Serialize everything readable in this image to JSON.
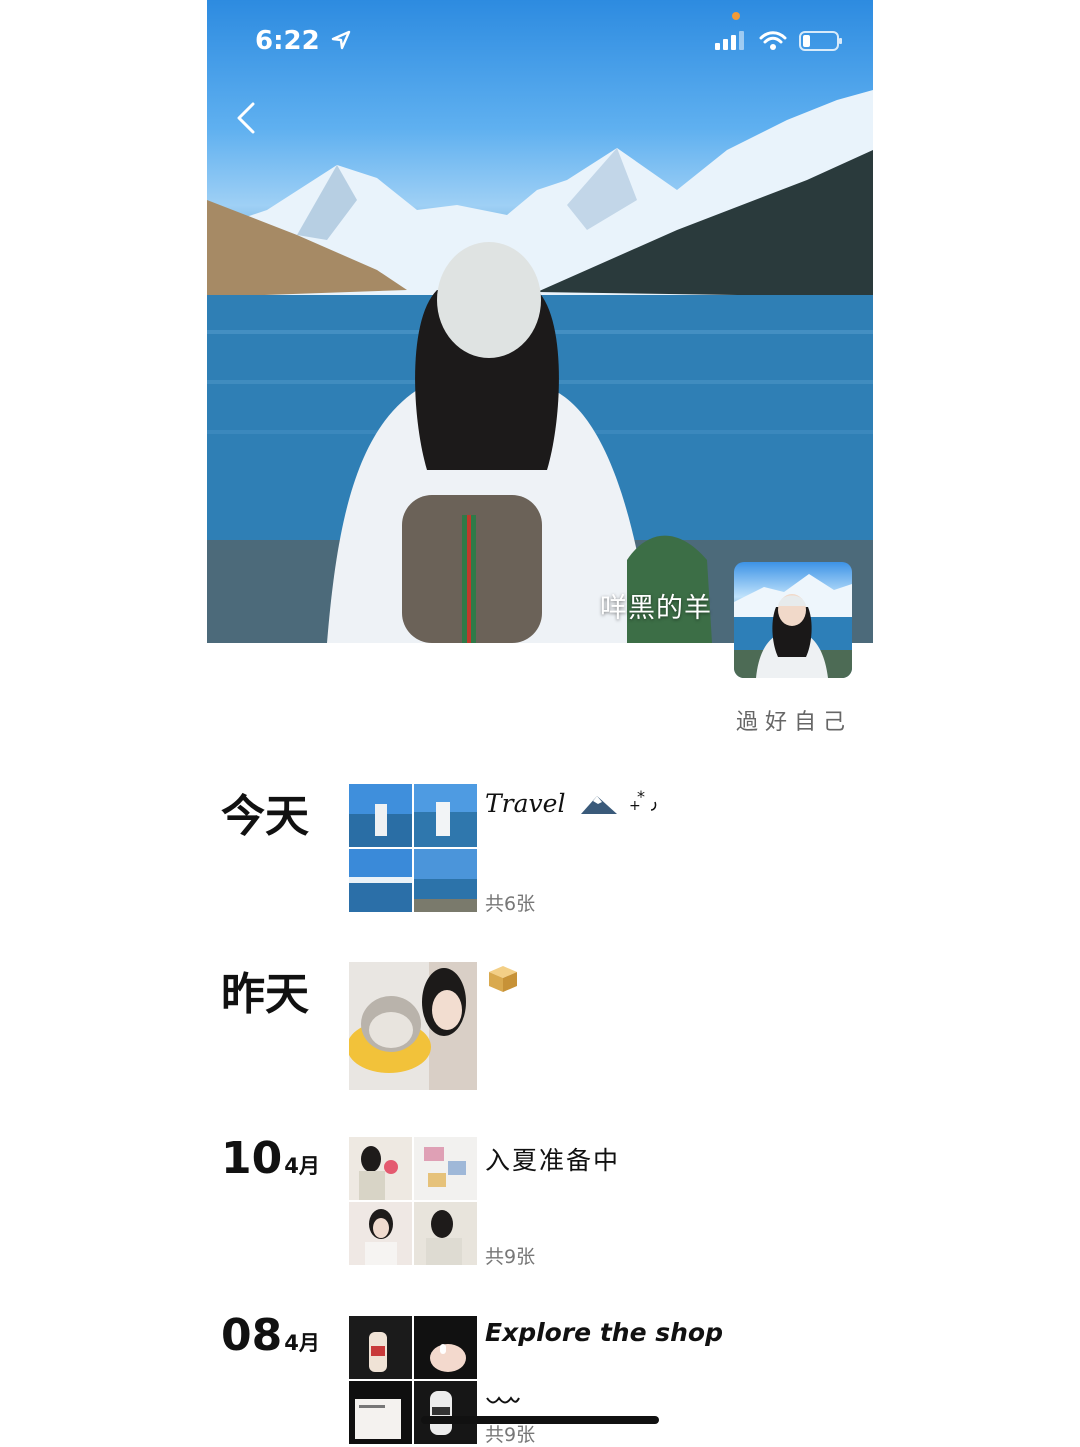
{
  "status_bar": {
    "time": "6:22"
  },
  "profile": {
    "name": "咩黑的羊",
    "motto": "過好自己"
  },
  "entries": [
    {
      "date": "今天",
      "caption": "Travel",
      "count": "共6张"
    },
    {
      "date": "昨天",
      "caption": ""
    },
    {
      "day": "10",
      "month": "4月",
      "caption": "入夏准备中",
      "count": "共9张"
    },
    {
      "day": "08",
      "month": "4月",
      "caption": "Explore the shop",
      "count": "共9张"
    }
  ],
  "colors": {
    "accent": "#f29b38",
    "sky": "#2d8be0",
    "lake": "#1f6da6"
  },
  "icons": [
    "location-arrow-icon",
    "signal-icon",
    "wifi-icon",
    "battery-icon",
    "back-chevron-icon",
    "mountain-icon",
    "sparkle-icon",
    "box-icon"
  ]
}
